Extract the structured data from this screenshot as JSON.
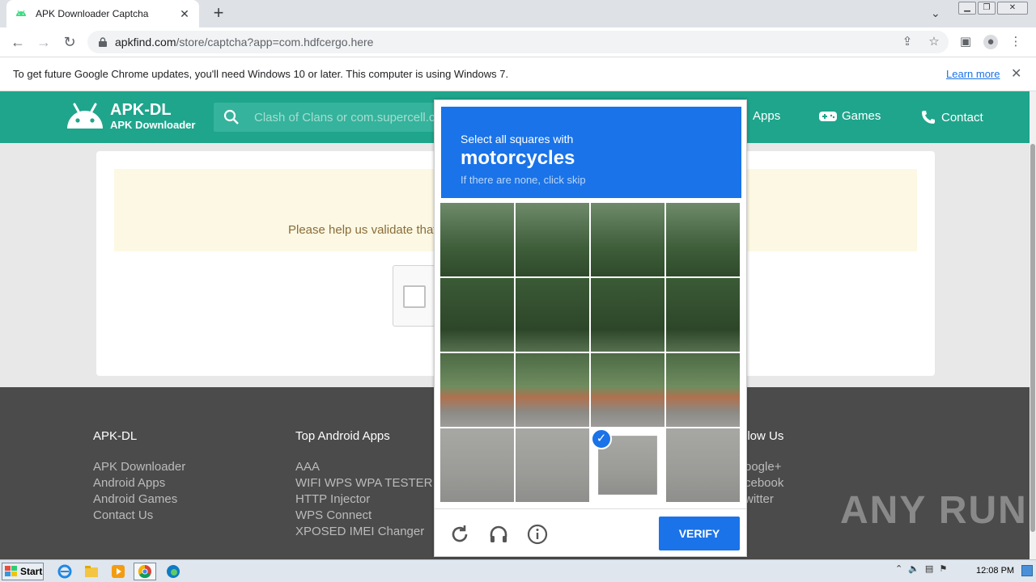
{
  "browser": {
    "tab_title": "APK Downloader Captcha",
    "url_host": "apkfind.com",
    "url_path": "/store/captcha?app=com.hdfcergo.here"
  },
  "infobar": {
    "message": "To get future Google Chrome updates, you'll need Windows 10 or later. This computer is using Windows 7.",
    "learn_more": "Learn more"
  },
  "site": {
    "brand_big": "APK-DL",
    "brand_small": "APK Downloader",
    "search_placeholder": "Clash of Clans or com.supercell.c",
    "nav": {
      "apps": "Apps",
      "games": "Games",
      "contact": "Contact"
    },
    "alert_text": "Please help us validate that"
  },
  "footer": {
    "col1": {
      "heading": "APK-DL",
      "links": [
        "APK Downloader",
        "Android Apps",
        "Android Games",
        "Contact Us"
      ]
    },
    "col2": {
      "heading": "Top Android Apps",
      "links": [
        "AAA",
        "WIFI WPS WPA TESTER",
        "HTTP Injector",
        "WPS Connect",
        "XPOSED IMEI Changer"
      ]
    },
    "col3": {
      "heading": "llow Us",
      "links": [
        "oogle+",
        "cebook",
        "witter"
      ]
    }
  },
  "captcha": {
    "line1": "Select all squares with",
    "target": "motorcycles",
    "line3": "If there are none, click skip",
    "verify_label": "VERIFY",
    "selected_tiles": [
      14
    ]
  },
  "watermark": "ANY  RUN",
  "taskbar": {
    "start_label": "Start",
    "clock": "12:08 PM"
  },
  "colors": {
    "site_green": "#1fa58c",
    "captcha_blue": "#1a73e8",
    "footer_gray": "#4b4b4b"
  }
}
